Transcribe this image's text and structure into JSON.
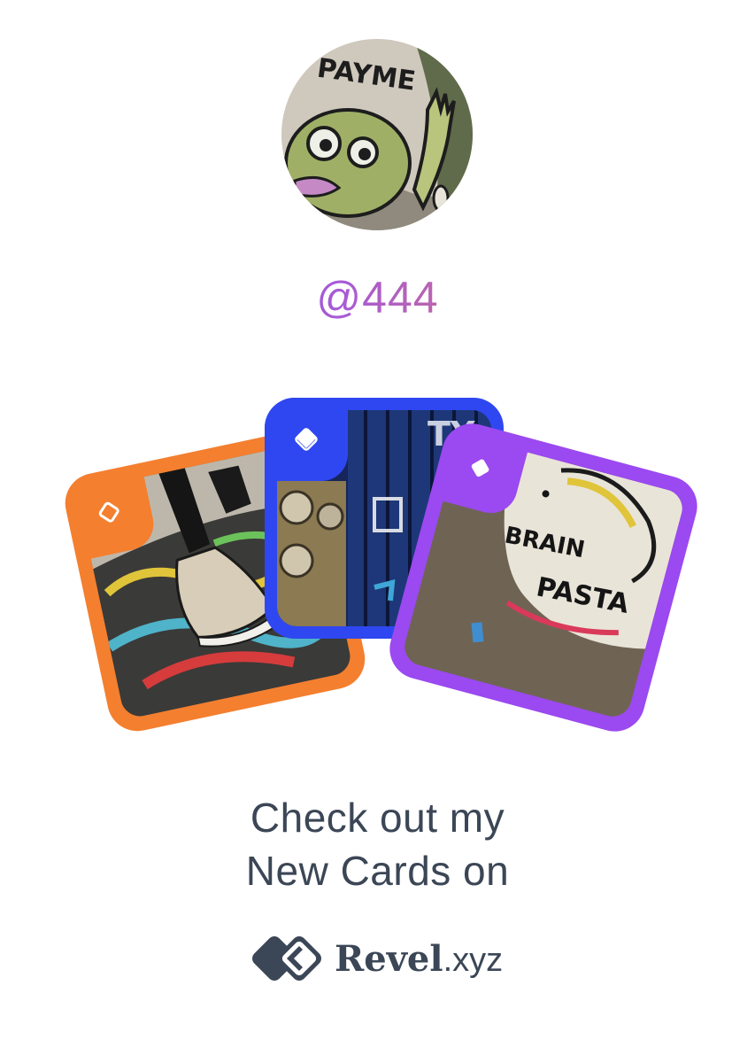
{
  "profile": {
    "handle": "@444",
    "avatar_icon": "graffiti-avatar-image"
  },
  "cards": [
    {
      "id": "orange",
      "color": "#f47f2f",
      "icon": "diamond-outline-icon",
      "image": "sneaker-graffiti-photo"
    },
    {
      "id": "blue",
      "color": "#2e47f0",
      "icon": "diamond-half-filled-icon",
      "image": "blue-wall-graffiti-photo"
    },
    {
      "id": "purple",
      "color": "#9b49f0",
      "icon": "diamond-filled-icon",
      "image": "brain-pasta-graffiti-photo"
    }
  ],
  "cta": {
    "line1": "Check out my",
    "line2": "New Cards on"
  },
  "brand": {
    "name": "Revel",
    "tld": ".xyz",
    "logo_icon": "revel-logo-icon",
    "color": "#3b4656"
  },
  "colors": {
    "text": "#3b4656",
    "gradient_start": "#5b63e6",
    "gradient_end": "#f0862f"
  }
}
